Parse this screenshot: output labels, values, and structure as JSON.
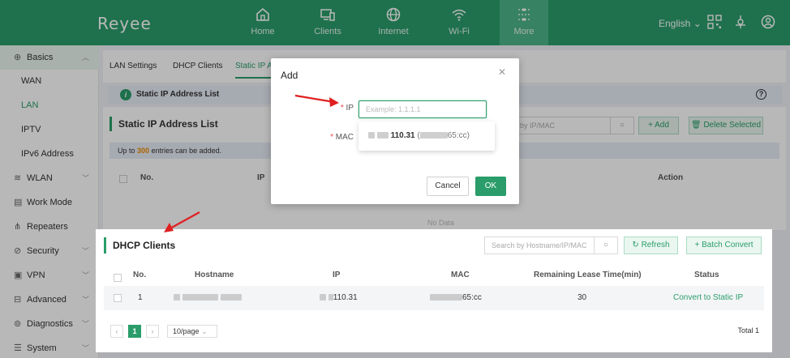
{
  "brand": "Reyee",
  "topnav": [
    {
      "label": "Home",
      "icon": "home-icon"
    },
    {
      "label": "Clients",
      "icon": "clients-icon"
    },
    {
      "label": "Internet",
      "icon": "globe-icon"
    },
    {
      "label": "Wi-Fi",
      "icon": "wifi-icon"
    },
    {
      "label": "More",
      "icon": "more-icon"
    }
  ],
  "language": "English",
  "sidebar": {
    "items": [
      {
        "label": "Basics",
        "icon": "globe-icon"
      },
      {
        "label": "WAN"
      },
      {
        "label": "LAN"
      },
      {
        "label": "IPTV"
      },
      {
        "label": "IPv6 Address"
      },
      {
        "label": "WLAN",
        "icon": "wifi-icon"
      },
      {
        "label": "Work Mode",
        "icon": "work-mode-icon"
      },
      {
        "label": "Repeaters",
        "icon": "repeater-icon"
      },
      {
        "label": "Security",
        "icon": "shield-icon"
      },
      {
        "label": "VPN",
        "icon": "vpn-icon"
      },
      {
        "label": "Advanced",
        "icon": "advanced-icon"
      },
      {
        "label": "Diagnostics",
        "icon": "diagnostics-icon"
      },
      {
        "label": "System",
        "icon": "system-icon"
      }
    ]
  },
  "tabs": [
    "LAN Settings",
    "DHCP Clients",
    "Static IP Ad"
  ],
  "info_bar": "Static IP Address List",
  "static_list": {
    "title": "Static IP Address List",
    "note_prefix": "Up to",
    "note_count": "300",
    "note_suffix": "entries can be added.",
    "search_placeholder": "rch by IP/MAC",
    "add_label": "+ Add",
    "delete_label": "Delete Selected",
    "columns": [
      "No.",
      "IP",
      "Action"
    ],
    "no_data": "No Data"
  },
  "modal": {
    "title": "Add",
    "ip_label": "IP",
    "ip_placeholder": "Example: 1.1.1.1",
    "mac_label": "MAC",
    "suggestion_ip": "110.31",
    "suggestion_mac": "65:cc",
    "cancel_label": "Cancel",
    "ok_label": "OK"
  },
  "dhcp": {
    "title": "DHCP Clients",
    "search_placeholder": "Search by Hostname/IP/MAC",
    "refresh_label": "Refresh",
    "batch_label": "+ Batch Convert",
    "columns": [
      "No.",
      "Hostname",
      "IP",
      "MAC",
      "Remaining Lease Time(min)",
      "Status"
    ],
    "rows": [
      {
        "no": "1",
        "ip": "110.31",
        "mac": "65:cc",
        "lease": "30",
        "status": "Convert to Static IP"
      }
    ],
    "page": "1",
    "per_page": "10/page",
    "total": "Total 1"
  },
  "colors": {
    "brand": "#2a9d6a",
    "warning": "#f08c00",
    "arrow": "#e02020"
  }
}
